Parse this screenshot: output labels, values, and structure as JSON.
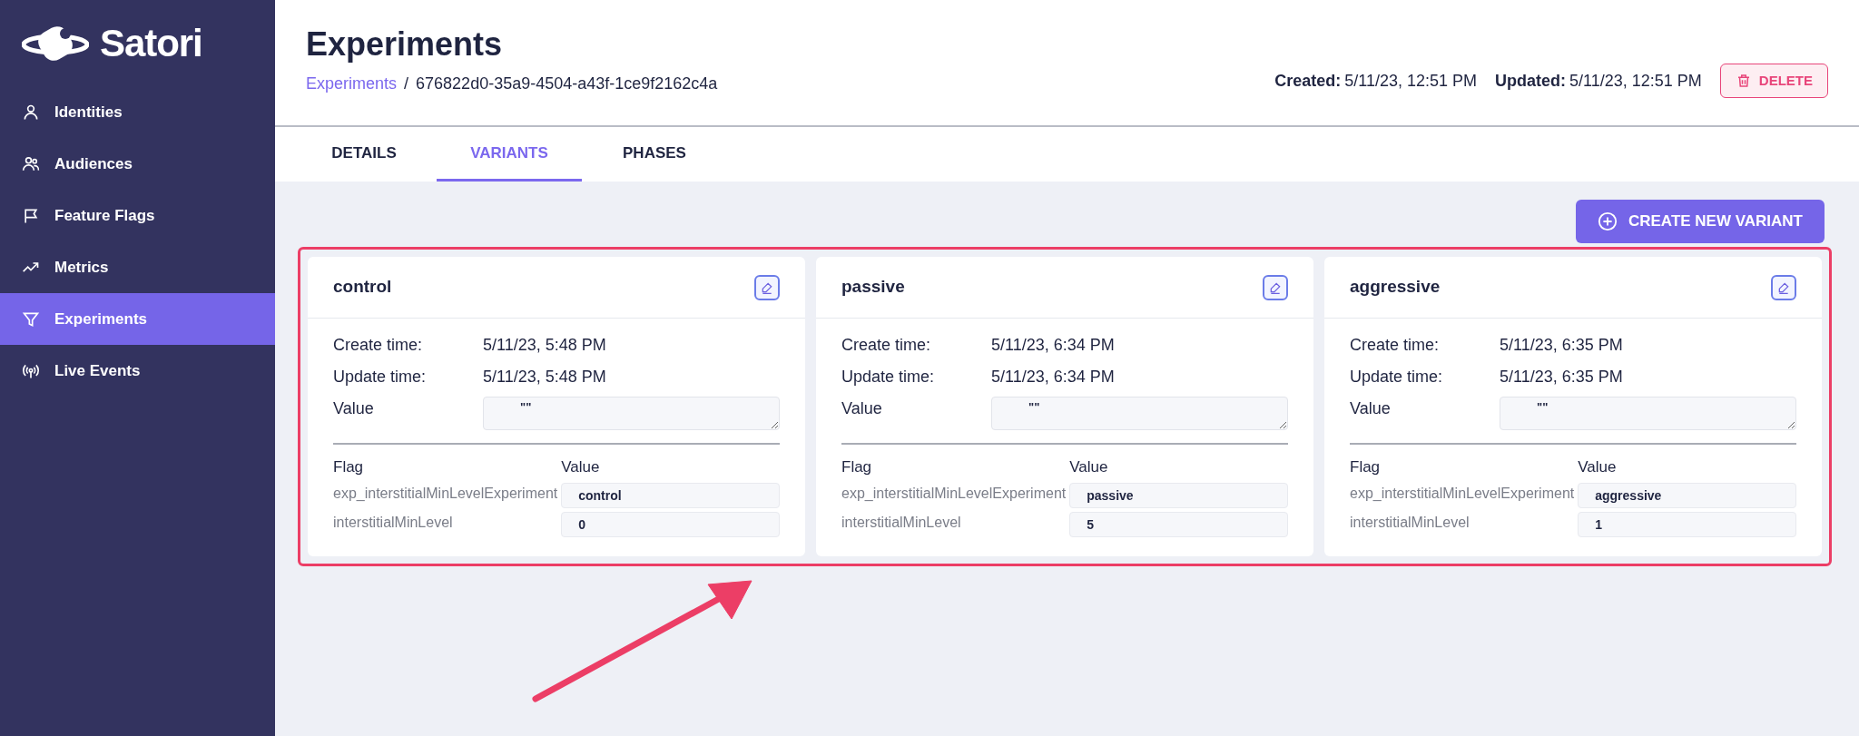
{
  "sidebar": {
    "logo": "Satori",
    "items": [
      {
        "label": "Identities",
        "selected": false
      },
      {
        "label": "Audiences",
        "selected": false
      },
      {
        "label": "Feature Flags",
        "selected": false
      },
      {
        "label": "Metrics",
        "selected": false
      },
      {
        "label": "Experiments",
        "selected": true
      },
      {
        "label": "Live Events",
        "selected": false
      }
    ]
  },
  "header": {
    "title": "Experiments",
    "breadcrumb_link": "Experiments",
    "breadcrumb_separator": "/",
    "breadcrumb_current": "676822d0-35a9-4504-a43f-1ce9f2162c4a",
    "created_label": "Created:",
    "created_value": "5/11/23, 12:51 PM",
    "updated_label": "Updated:",
    "updated_value": "5/11/23, 12:51 PM",
    "delete_button": "DELETE"
  },
  "tabs": [
    {
      "label": "DETAILS",
      "selected": false
    },
    {
      "label": "VARIANTS",
      "selected": true
    },
    {
      "label": "PHASES",
      "selected": false
    }
  ],
  "create_button": "CREATE NEW VARIANT",
  "variants": [
    {
      "name": "control",
      "create_label": "Create time:",
      "create_time": "5/11/23, 5:48 PM",
      "update_label": "Update time:",
      "update_time": "5/11/23, 5:48 PM",
      "value_label": "Value",
      "value": "\"\"",
      "flag_header": "Flag",
      "value_header": "Value",
      "flags": [
        {
          "flag": "exp_interstitialMinLevelExperiment",
          "value": "control"
        },
        {
          "flag": "interstitialMinLevel",
          "value": "0"
        }
      ]
    },
    {
      "name": "passive",
      "create_label": "Create time:",
      "create_time": "5/11/23, 6:34 PM",
      "update_label": "Update time:",
      "update_time": "5/11/23, 6:34 PM",
      "value_label": "Value",
      "value": "\"\"",
      "flag_header": "Flag",
      "value_header": "Value",
      "flags": [
        {
          "flag": "exp_interstitialMinLevelExperiment",
          "value": "passive"
        },
        {
          "flag": "interstitialMinLevel",
          "value": "5"
        }
      ]
    },
    {
      "name": "aggressive",
      "create_label": "Create time:",
      "create_time": "5/11/23, 6:35 PM",
      "update_label": "Update time:",
      "update_time": "5/11/23, 6:35 PM",
      "value_label": "Value",
      "value": "\"\"",
      "flag_header": "Flag",
      "value_header": "Value",
      "flags": [
        {
          "flag": "exp_interstitialMinLevelExperiment",
          "value": "aggressive"
        },
        {
          "flag": "interstitialMinLevel",
          "value": "1"
        }
      ]
    }
  ]
}
